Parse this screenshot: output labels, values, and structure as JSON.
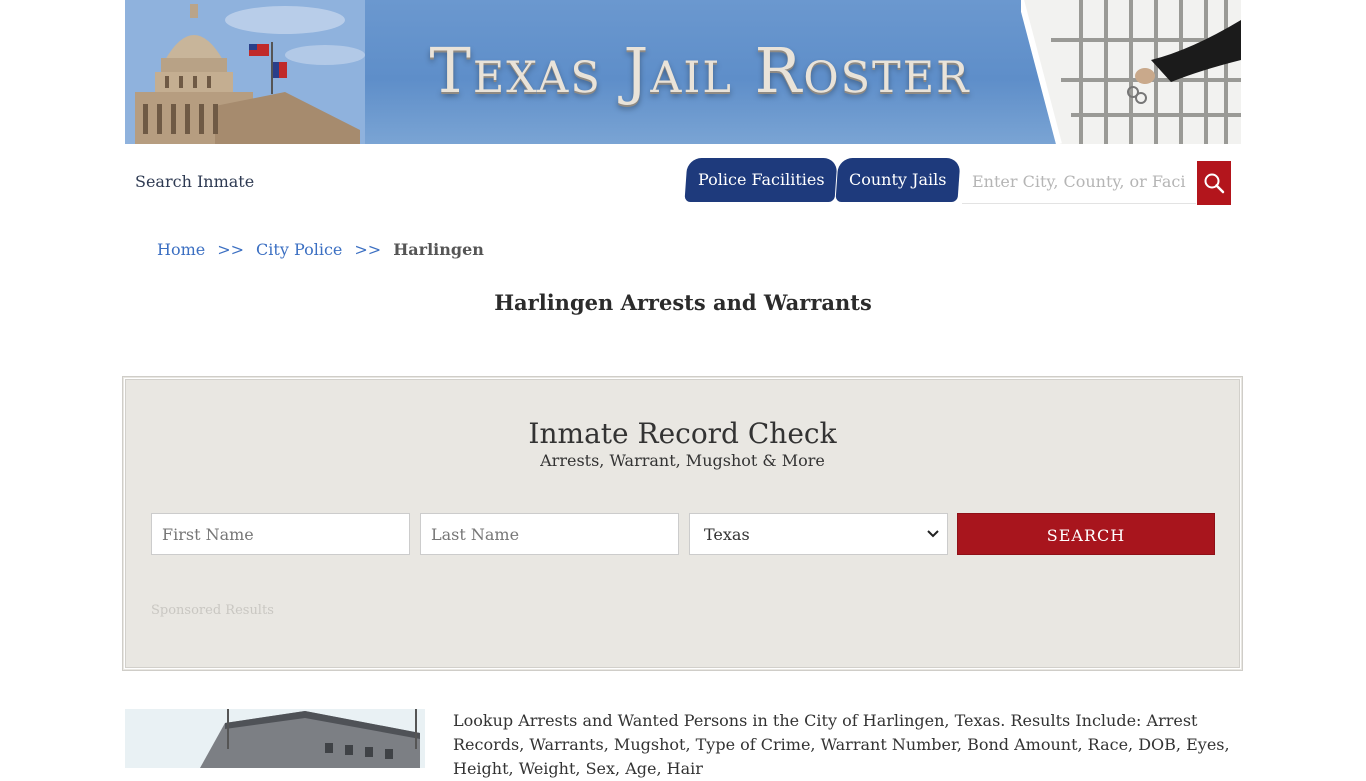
{
  "banner": {
    "title": "Texas Jail Roster"
  },
  "nav": {
    "search_inmate": "Search Inmate",
    "tabs": [
      {
        "label": "Police Facilities"
      },
      {
        "label": "County Jails"
      }
    ],
    "search_placeholder": "Enter City, County, or Facility"
  },
  "breadcrumb": {
    "home": "Home",
    "sep1": ">>",
    "city_police": "City Police",
    "sep2": ">>",
    "current": "Harlingen"
  },
  "page_title": "Harlingen Arrests and Warrants",
  "record_check": {
    "title": "Inmate Record Check",
    "subtitle": "Arrests, Warrant, Mugshot & More",
    "first_name_placeholder": "First Name",
    "last_name_placeholder": "Last Name",
    "state_value": "Texas",
    "search_label": "SEARCH",
    "sponsored": "Sponsored Results"
  },
  "intro": "Lookup Arrests and Wanted Persons in the City of Harlingen, Texas. Results Include: Arrest Records, Warrants, Mugshot, Type of Crime, Warrant Number, Bond Amount, Race, DOB, Eyes, Height, Weight, Sex, Age, Hair",
  "colors": {
    "nav_tab": "#1e3a7c",
    "accent_red": "#a8151d",
    "link": "#3b6fc2",
    "panel_bg": "#e9e7e2"
  }
}
